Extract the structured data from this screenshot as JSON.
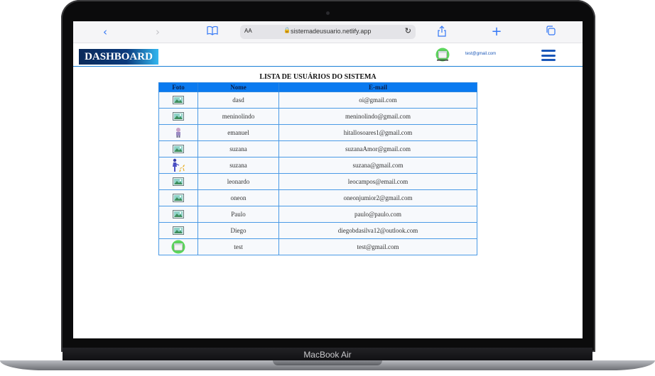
{
  "device": {
    "model_label": "MacBook Air"
  },
  "browser": {
    "text_size_label": "AA",
    "url": "sistemadeusuario.netlify.app"
  },
  "header": {
    "dashboard_label": "DASHBOARD",
    "user_email": "test@gmail.com"
  },
  "table": {
    "title": "LISTA DE USUÁRIOS DO SISTEMA",
    "columns": [
      "Foto",
      "Nome",
      "E-mail"
    ],
    "rows": [
      {
        "photo": "image-placeholder-icon",
        "name": "dasd",
        "email": "oi@gmail.com"
      },
      {
        "photo": "image-placeholder-icon",
        "name": "meninolindo",
        "email": "meninolindo@gmail.com"
      },
      {
        "photo": "character-avatar-icon",
        "name": "emanuel",
        "email": "hitallosoares1@gmail.com"
      },
      {
        "photo": "image-placeholder-icon",
        "name": "suzana",
        "email": "suzanaAmor@gmail.com"
      },
      {
        "photo": "person-with-dog-icon",
        "name": "suzana",
        "email": "suzana@gmail.com"
      },
      {
        "photo": "image-placeholder-icon",
        "name": "leonardo",
        "email": "leocampos@email.com"
      },
      {
        "photo": "image-placeholder-icon",
        "name": "oneon",
        "email": "oneonjumior2@gmail.com"
      },
      {
        "photo": "image-placeholder-icon",
        "name": "Paulo",
        "email": "paulo@paulo.com"
      },
      {
        "photo": "image-placeholder-icon",
        "name": "Diego",
        "email": "diegobdasilva12@outlook.com"
      },
      {
        "photo": "round-green-avatar-icon",
        "name": "test",
        "email": "test@gmail.com"
      }
    ]
  },
  "colors": {
    "accent": "#0a7af0",
    "header_link": "#1a57b8",
    "safari_blue": "#3478f6"
  }
}
